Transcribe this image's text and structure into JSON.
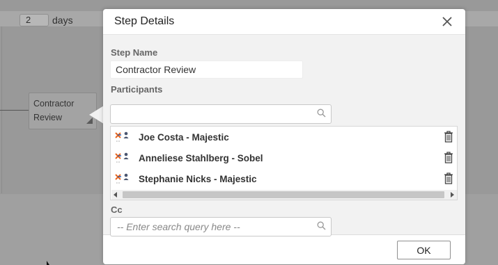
{
  "background": {
    "days_value": "2",
    "days_label": "days",
    "node_label_line1": "Contractor",
    "node_label_line2": "Review"
  },
  "dialog": {
    "title": "Step Details",
    "step_name_label": "Step Name",
    "step_name_value": "Contractor Review",
    "participants_label": "Participants",
    "participants_search_value": "",
    "participants": [
      {
        "name": "Joe Costa - Majestic",
        "icon": "user-group-icon"
      },
      {
        "name": "Anneliese Stahlberg - Sobel",
        "icon": "user-group-icon"
      },
      {
        "name": "Stephanie Nicks - Majestic",
        "icon": "user-group-icon"
      }
    ],
    "cc_label": "Cc",
    "cc_placeholder": "-- Enter search query here --",
    "ok_label": "OK"
  },
  "colors": {
    "overlay": "#999999",
    "dialog_body": "#f2f2f2",
    "participant_icon_orange": "#e8641c",
    "participant_icon_blue": "#2e5aa8"
  }
}
